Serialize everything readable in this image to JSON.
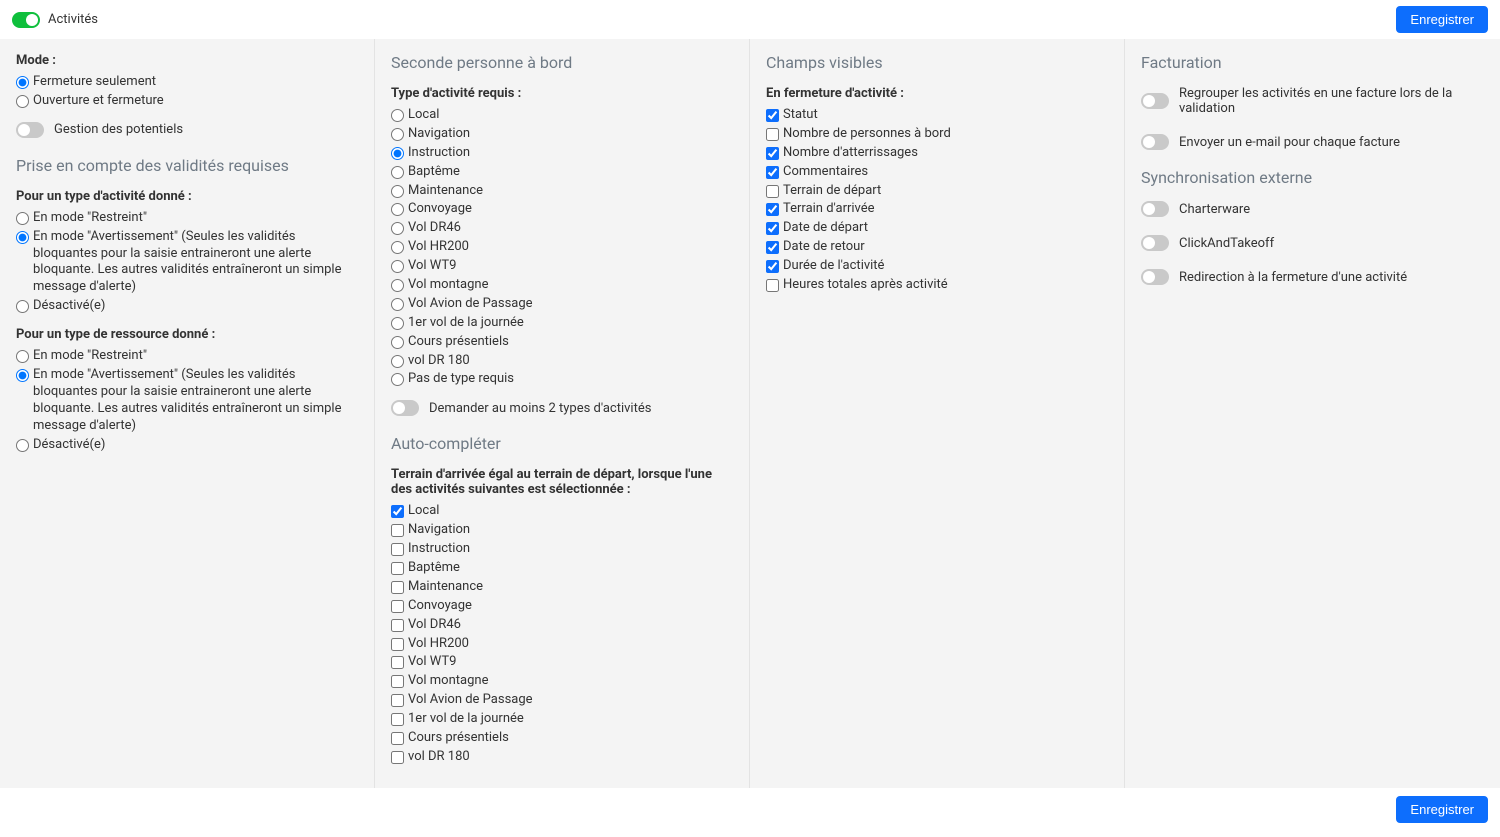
{
  "header": {
    "activites_label": "Activités",
    "save_label": "Enregistrer"
  },
  "col1": {
    "mode_label": "Mode :",
    "mode_options": {
      "fermeture": "Fermeture seulement",
      "ouverture": "Ouverture et fermeture"
    },
    "gestion_potentiels": "Gestion des potentiels",
    "validites_title": "Prise en compte des validités requises",
    "activite_label": "Pour un type d'activité donné :",
    "ressource_label": "Pour un type de ressource donné :",
    "validity_options": {
      "restreint": "En mode \"Restreint\"",
      "avertissement": "En mode \"Avertissement\" (Seules les validités bloquantes pour la saisie entraineront une alerte bloquante. Les autres validités entraîneront un simple message d'alerte)",
      "desactive": "Désactivé(e)"
    }
  },
  "col2": {
    "title": "Seconde personne à bord",
    "type_requis_label": "Type d'activité requis :",
    "radio_items": [
      "Local",
      "Navigation",
      "Instruction",
      "Baptême",
      "Maintenance",
      "Convoyage",
      "Vol DR46",
      "Vol HR200",
      "Vol WT9",
      "Vol montagne",
      "Vol Avion de Passage",
      "1er vol de la journée",
      "Cours présentiels",
      "vol DR 180",
      "Pas de type requis"
    ],
    "radio_checked_index": 2,
    "min2_label": "Demander au moins 2 types d'activités",
    "auto_title": "Auto-compléter",
    "auto_desc": "Terrain d'arrivée égal au terrain de départ, lorsque l'une des activités suivantes est sélectionnée :",
    "check_items": [
      "Local",
      "Navigation",
      "Instruction",
      "Baptême",
      "Maintenance",
      "Convoyage",
      "Vol DR46",
      "Vol HR200",
      "Vol WT9",
      "Vol montagne",
      "Vol Avion de Passage",
      "1er vol de la journée",
      "Cours présentiels",
      "vol DR 180"
    ],
    "check_checked": [
      true,
      false,
      false,
      false,
      false,
      false,
      false,
      false,
      false,
      false,
      false,
      false,
      false,
      false
    ]
  },
  "col3": {
    "title": "Champs visibles",
    "fermeture_label": "En fermeture d'activité :",
    "items": [
      {
        "label": "Statut",
        "checked": true
      },
      {
        "label": "Nombre de personnes à bord",
        "checked": false
      },
      {
        "label": "Nombre d'atterrissages",
        "checked": true
      },
      {
        "label": "Commentaires",
        "checked": true
      },
      {
        "label": "Terrain de départ",
        "checked": false
      },
      {
        "label": "Terrain d'arrivée",
        "checked": true
      },
      {
        "label": "Date de départ",
        "checked": true
      },
      {
        "label": "Date de retour",
        "checked": true
      },
      {
        "label": "Durée de l'activité",
        "checked": true
      },
      {
        "label": "Heures totales après activité",
        "checked": false
      }
    ]
  },
  "col4": {
    "title": "Facturation",
    "regrouper": "Regrouper les activités en une facture lors de la validation",
    "email": "Envoyer un e-mail pour chaque facture",
    "sync_title": "Synchronisation externe",
    "charterware": "Charterware",
    "clickandtakeoff": "ClickAndTakeoff",
    "redirection": "Redirection à la fermeture d'une activité"
  }
}
